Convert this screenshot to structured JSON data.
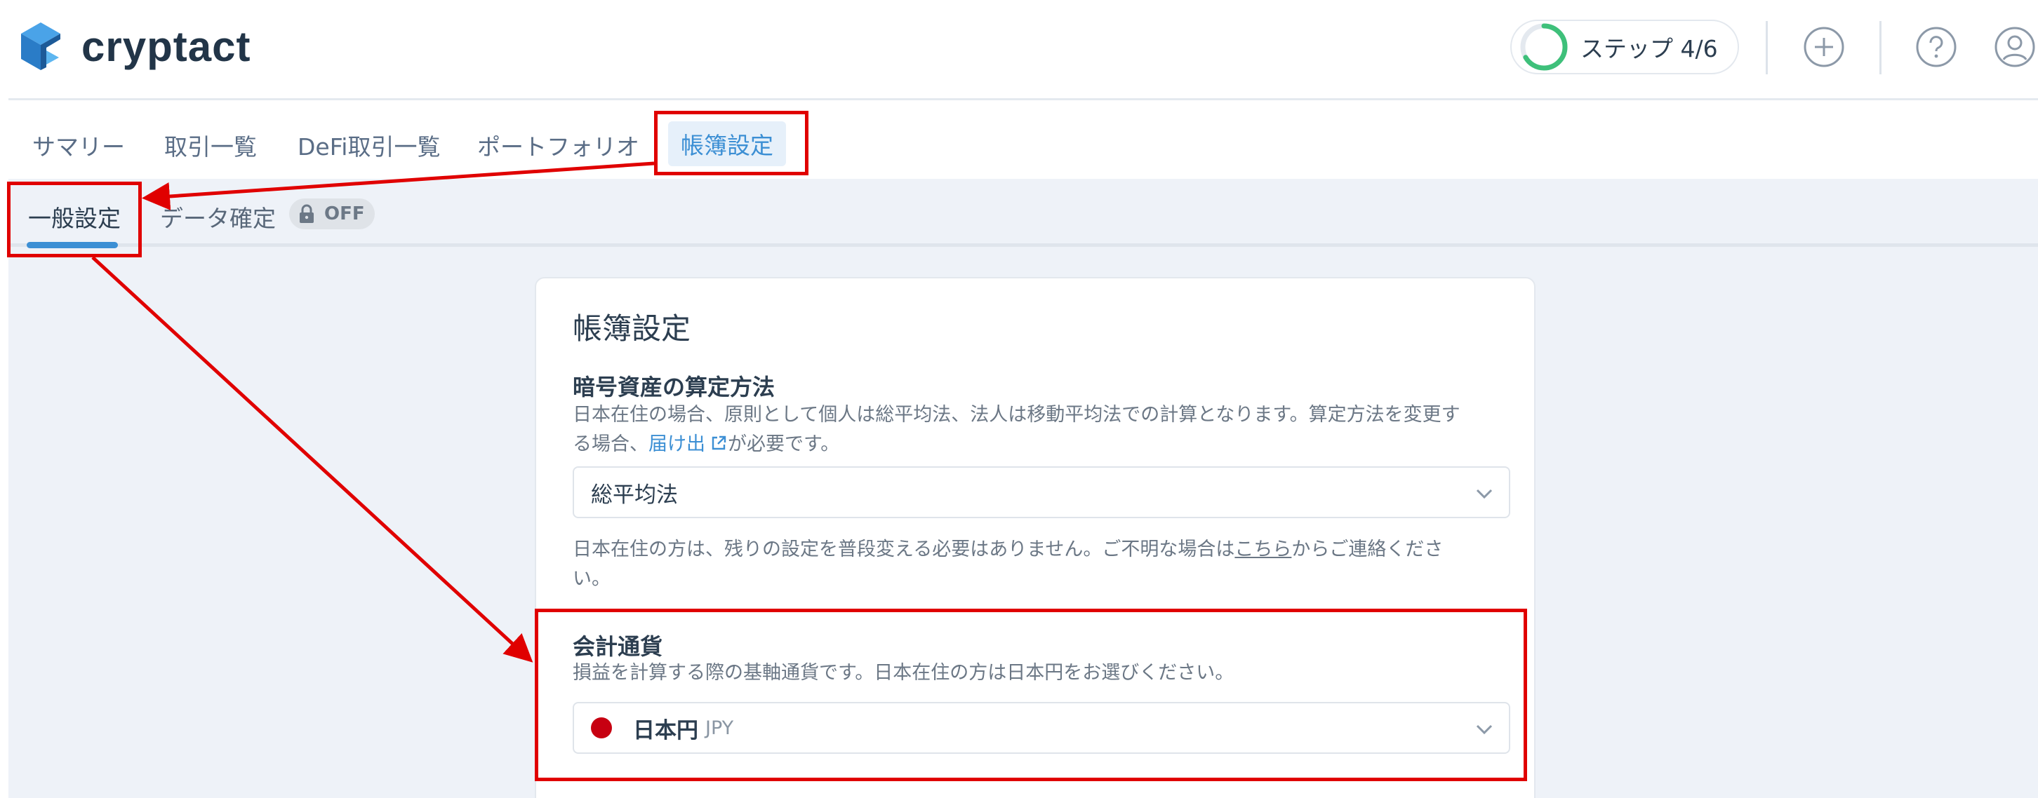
{
  "header": {
    "logo_text": "cryptact",
    "step_label": "ステップ 4/6",
    "step_progress": 0.667,
    "icons": [
      "plus-circle-icon",
      "help-circle-icon",
      "user-icon"
    ]
  },
  "tabs": [
    {
      "label": "サマリー"
    },
    {
      "label": "取引一覧"
    },
    {
      "label": "DeFi取引一覧"
    },
    {
      "label": "ポートフォリオ"
    },
    {
      "label": "帳簿設定",
      "active": true
    }
  ],
  "subtabs": {
    "general": "一般設定",
    "data_confirm": "データ確定",
    "lock_status": "OFF"
  },
  "card": {
    "title": "帳簿設定",
    "method": {
      "title": "暗号資産の算定方法",
      "desc_line1": "日本在住の場合、原則として個人は総平均法、法人は移動平均法での計算となります。算定方法を変更す",
      "desc_line2_pre": "る場合、",
      "desc_link": "届け出",
      "desc_line2_post": "が必要です。",
      "selected": "総平均法",
      "note_pre": "日本在住の方は、残りの設定を普段変える必要はありません。ご不明な場合は",
      "note_link": "こちら",
      "note_post": "からご連絡くださ",
      "note_line2": "い。"
    },
    "currency": {
      "title": "会計通貨",
      "desc": "損益を計算する際の基軸通貨です。日本在住の方は日本円をお選びください。",
      "selected": "日本円",
      "selected_code": "JPY"
    }
  },
  "colors": {
    "accent": "#3c8fd4",
    "annotation": "#e00000",
    "progress": "#3ec07a",
    "flag": "#c70011"
  }
}
